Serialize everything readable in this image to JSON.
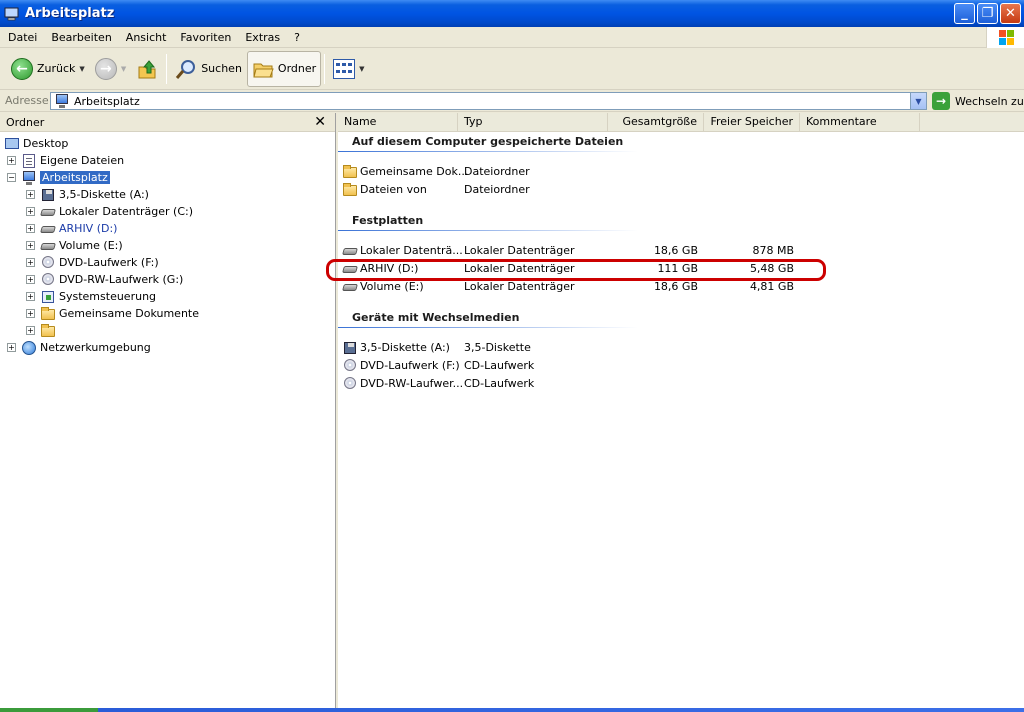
{
  "window": {
    "title": "Arbeitsplatz",
    "accent_color": "#0054e3",
    "highlight_color": "#cc0000"
  },
  "menu": [
    "Datei",
    "Bearbeiten",
    "Ansicht",
    "Favoriten",
    "Extras",
    "?"
  ],
  "toolbar": {
    "back_label": "Zurück",
    "search_label": "Suchen",
    "folders_label": "Ordner"
  },
  "address": {
    "label": "Adresse",
    "value": "Arbeitsplatz",
    "go_label": "Wechseln zu"
  },
  "folders_pane": {
    "title": "Ordner",
    "tree": [
      {
        "label": "Desktop",
        "icon": "desktop-icon"
      },
      {
        "label": "Eigene Dateien",
        "icon": "documents-icon"
      },
      {
        "label": "Arbeitsplatz",
        "icon": "computer-icon"
      },
      {
        "label": "3,5-Diskette (A:)",
        "icon": "floppy-icon"
      },
      {
        "label": "Lokaler Datenträger (C:)",
        "icon": "drive-icon"
      },
      {
        "label": "ARHIV (D:)",
        "icon": "drive-icon"
      },
      {
        "label": "Volume (E:)",
        "icon": "drive-icon"
      },
      {
        "label": "DVD-Laufwerk (F:)",
        "icon": "cd-icon"
      },
      {
        "label": "DVD-RW-Laufwerk (G:)",
        "icon": "cd-icon"
      },
      {
        "label": "Systemsteuerung",
        "icon": "control-panel-icon"
      },
      {
        "label": "Gemeinsame Dokumente",
        "icon": "folder-icon"
      },
      {
        "label": "",
        "icon": "folder-icon"
      },
      {
        "label": "Netzwerkumgebung",
        "icon": "network-icon"
      }
    ]
  },
  "columns": [
    "Name",
    "Typ",
    "Gesamtgröße",
    "Freier Speicher",
    "Kommentare"
  ],
  "groups": {
    "stored_files": {
      "title": "Auf diesem Computer gespeicherte Dateien",
      "rows": [
        {
          "name": "Gemeinsame Dok...",
          "type": "Dateiordner",
          "size": "",
          "free": ""
        },
        {
          "name": "Dateien von",
          "type": "Dateiordner",
          "size": "",
          "free": ""
        }
      ]
    },
    "hard_disks": {
      "title": "Festplatten",
      "rows": [
        {
          "name": "Lokaler Datenträ...",
          "type": "Lokaler Datenträger",
          "size": "18,6 GB",
          "free": "878 MB"
        },
        {
          "name": "ARHIV (D:)",
          "type": "Lokaler Datenträger",
          "size": "111 GB",
          "free": "5,48 GB"
        },
        {
          "name": "Volume (E:)",
          "type": "Lokaler Datenträger",
          "size": "18,6 GB",
          "free": "4,81 GB"
        }
      ]
    },
    "removable": {
      "title": "Geräte mit Wechselmedien",
      "rows": [
        {
          "name": "3,5-Diskette (A:)",
          "type": "3,5-Diskette",
          "size": "",
          "free": ""
        },
        {
          "name": "DVD-Laufwerk (F:)",
          "type": "CD-Laufwerk",
          "size": "",
          "free": ""
        },
        {
          "name": "DVD-RW-Laufwer...",
          "type": "CD-Laufwerk",
          "size": "",
          "free": ""
        }
      ]
    }
  }
}
